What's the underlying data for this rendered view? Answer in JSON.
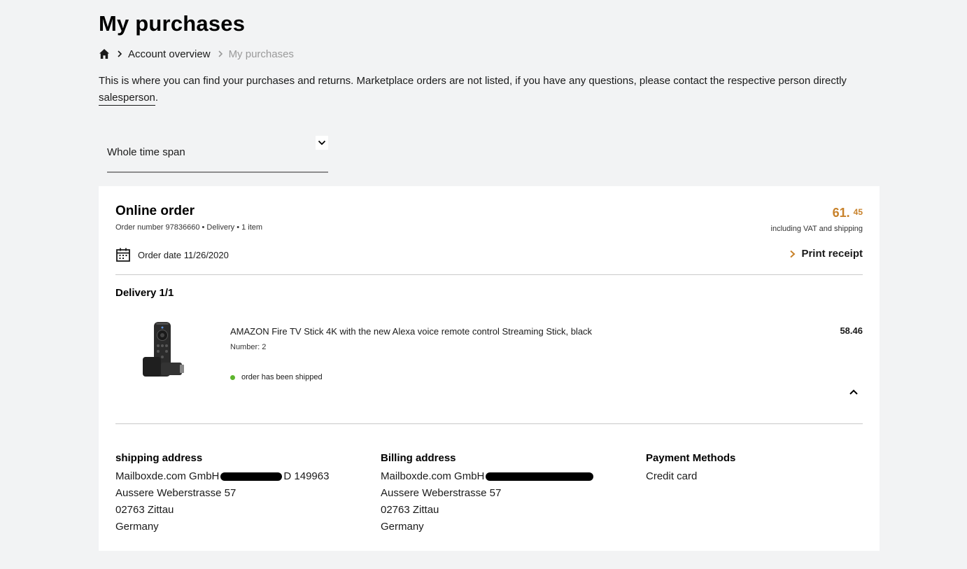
{
  "page": {
    "title": "My purchases",
    "intro_text": "This is where you can find your purchases and returns. Marketplace orders are not listed, if you have any questions, please contact the respective person directly",
    "intro_link": "salesperson",
    "intro_end": "."
  },
  "breadcrumb": {
    "home_icon": "home-icon",
    "items": [
      "Account overview",
      "My purchases"
    ]
  },
  "filter": {
    "selected": "Whole time span"
  },
  "order": {
    "type": "Online order",
    "meta": "Order number 97836660 • Delivery • 1 item",
    "total_int": "61.",
    "total_dec": "45",
    "total_note": "including VAT and shipping",
    "date_label": "Order date 11/26/2020",
    "print_label": "Print receipt",
    "delivery_title": "Delivery 1/1",
    "accent_color": "#c8822b",
    "item": {
      "name": "AMAZON Fire TV Stick 4K with the new Alexa voice remote control Streaming Stick, black",
      "quantity": "Number: 2",
      "price": "58.46",
      "status": "order has been shipped",
      "status_color": "#5db52d"
    }
  },
  "addresses": {
    "shipping": {
      "title": "shipping address",
      "line1_prefix": "Mailboxde.com GmbH",
      "line1_suffix": "D 149963",
      "line2": "Aussere Weberstrasse 57",
      "line3": "02763 Zittau",
      "line4": "Germany"
    },
    "billing": {
      "title": "Billing address",
      "line1_prefix": "Mailboxde.com GmbH",
      "line2": "Aussere Weberstrasse 57",
      "line3": "02763 Zittau",
      "line4": "Germany"
    },
    "payment": {
      "title": "Payment Methods",
      "method": "Credit card"
    }
  }
}
